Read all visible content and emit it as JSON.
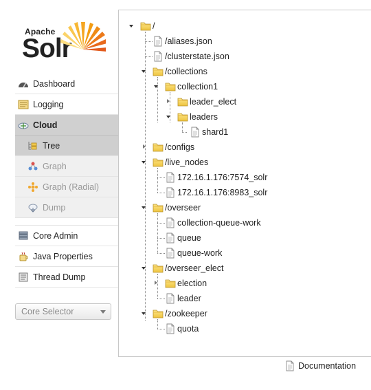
{
  "logo": {
    "brand_small": "Apache",
    "brand_big": "Solr"
  },
  "nav": {
    "items": [
      {
        "label": "Dashboard"
      },
      {
        "label": "Logging"
      },
      {
        "label": "Cloud"
      }
    ],
    "cloud_sub": [
      {
        "label": "Tree"
      },
      {
        "label": "Graph"
      },
      {
        "label": "Graph (Radial)"
      },
      {
        "label": "Dump"
      }
    ],
    "items2": [
      {
        "label": "Core Admin"
      },
      {
        "label": "Java Properties"
      },
      {
        "label": "Thread Dump"
      }
    ]
  },
  "core_selector": {
    "label": "Core Selector"
  },
  "tree": {
    "root": "/",
    "aliases": "/aliases.json",
    "clusterstate": "/clusterstate.json",
    "collections": "/collections",
    "collection1": "collection1",
    "leader_elect": "leader_elect",
    "leaders": "leaders",
    "shard1": "shard1",
    "configs": "/configs",
    "live_nodes": "/live_nodes",
    "node1": "172.16.1.176:7574_solr",
    "node2": "172.16.1.176:8983_solr",
    "overseer": "/overseer",
    "cqw": "collection-queue-work",
    "queue": "queue",
    "queue_work": "queue-work",
    "overseer_elect": "/overseer_elect",
    "election": "election",
    "leader": "leader",
    "zookeeper": "/zookeeper",
    "quota": "quota"
  },
  "footer": {
    "documentation": "Documentation"
  }
}
